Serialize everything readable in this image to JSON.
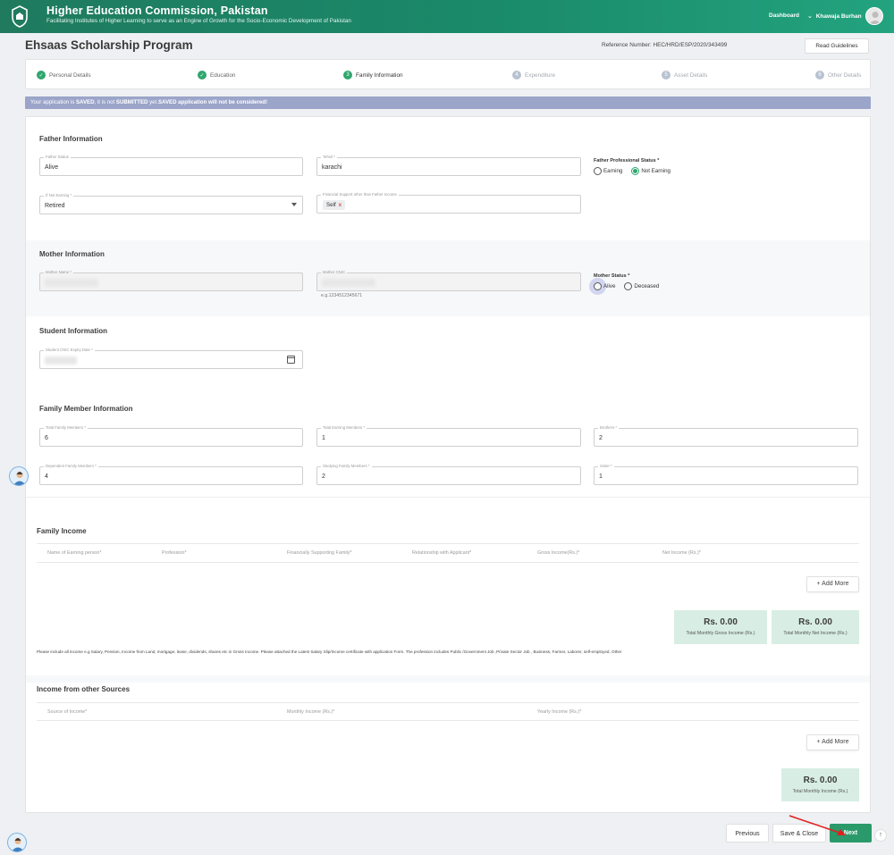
{
  "header": {
    "title": "Higher Education Commission, Pakistan",
    "subtitle": "Facilitating Institutes of Higher Learning to serve as an Engine of Growth for the Socio-Economic Development of Pakistan",
    "dashboard_label": "Dashboard",
    "user_name": "Khawaja Burhan",
    "user_chevron": "⌄"
  },
  "page": {
    "title": "Ehsaas Scholarship Program",
    "reference": "Reference Number: HEC/HRD/ESP/2020/343499",
    "guidelines_label": "Read Guidelines"
  },
  "steps": [
    {
      "label": "Personal Details",
      "symbol": "✓",
      "state": "done"
    },
    {
      "label": "Education",
      "symbol": "✓",
      "state": "done"
    },
    {
      "label": "Family Information",
      "symbol": "3",
      "state": "active"
    },
    {
      "label": "Expenditure",
      "symbol": "4",
      "state": "pending"
    },
    {
      "label": "Asset Details",
      "symbol": "5",
      "state": "pending"
    },
    {
      "label": "Other Details",
      "symbol": "6",
      "state": "pending"
    }
  ],
  "banner": {
    "p1": "Your application is ",
    "saved": "SAVED",
    "p2": ", it is not ",
    "submitted": "SUBMITTED",
    "p3": " yet.",
    "p4": "SAVED application will not be considered!"
  },
  "father": {
    "title": "Father Information",
    "status_label": "Father Status",
    "status_value": "Alive",
    "tehsil_label": "Tehsil *",
    "tehsil_value": "karachi",
    "professional_status_label": "Father Professional Status *",
    "opt_earning": "Earning",
    "opt_not_earning": "Not Earning",
    "not_earning_label": "If Not Earning *",
    "not_earning_value": "Retired",
    "support_label": "Financial Support other than Father Income",
    "support_chip": "Self",
    "support_chip_remove": "x"
  },
  "mother": {
    "title": "Mother Information",
    "name_label": "Mother Name *",
    "cnic_label": "Mother CNIC",
    "cnic_hint": "e.g.1234512345671",
    "status_label": "Mother Status *",
    "opt_alive": "Alive",
    "opt_deceased": "Deceased"
  },
  "student": {
    "title": "Student Information",
    "cnic_expiry_label": "Student CNIC Expiry Date *"
  },
  "family_member": {
    "title": "Family Member Information",
    "total_members_label": "Total Family Members *",
    "total_members_value": "6",
    "total_earning_label": "Total Earning Members *",
    "total_earning_value": "1",
    "brothers_label": "Brothers *",
    "brothers_value": "2",
    "dependent_label": "Dependent Family Members *",
    "dependent_value": "4",
    "studying_label": "Studying Family Members *",
    "studying_value": "2",
    "sister_label": "Sister *",
    "sister_value": "1"
  },
  "family_income": {
    "title": "Family Income",
    "columns": [
      "Name of Earning person*",
      "Profession*",
      "Financially Supporting Family*",
      "Relationship with Applicant*",
      "Gross Income(Rs.)*",
      "Net Income (Rs.)*"
    ],
    "add_more": "+ Add More",
    "gross_amount": "Rs. 0.00",
    "gross_label": "Total Monthly Gross Income (Rs.)",
    "net_amount": "Rs. 0.00",
    "net_label": "Total Monthly Net Income (Rs.)",
    "note": "Please include all income e.g Salary, Pension, Income from Land, mortgage, lease, dividends, shares etc in Gross Income. Please attached the Latest Salary Slip/Income certificate with application Form. The profession includes Public /Government Job ,Private Sector Job , Business, Farmer, Laborer, self-employed, Other"
  },
  "other_income": {
    "title": "Income from other Sources",
    "columns": [
      "Source of Income*",
      "Monthly Income (Rs.)*",
      "Yearly Income (Rs.)*"
    ],
    "add_more": "+ Add More",
    "total_amount": "Rs. 0.00",
    "total_label": "Total Monthly Income (Rs.)"
  },
  "footer": {
    "previous": "Previous",
    "save_close": "Save & Close",
    "next": "Next",
    "up": "↑"
  },
  "colors": {
    "brand_green": "#1f7a5e",
    "accent": "#2fa66e",
    "banner": "#9ba4c9",
    "summary_bg": "#d8eee5"
  }
}
